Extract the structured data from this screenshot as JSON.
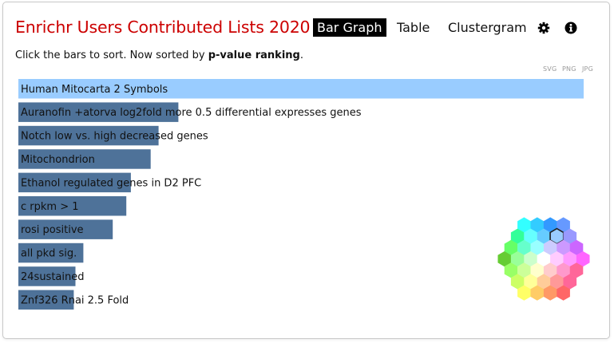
{
  "header": {
    "title": "Enrichr Users Contributed Lists 2020",
    "tabs": [
      {
        "label": "Bar Graph",
        "active": true
      },
      {
        "label": "Table",
        "active": false
      },
      {
        "label": "Clustergram",
        "active": false
      }
    ],
    "icons": [
      "gear-icon",
      "info-icon"
    ]
  },
  "subtitle": {
    "prefix": "Click the bars to sort. Now sorted by ",
    "emphasis": "p-value ranking",
    "suffix": "."
  },
  "export": {
    "svg": "SVG",
    "png": "PNG",
    "jpg": "JPG"
  },
  "colors": {
    "title": "#cc0000",
    "top_bar": "#99ccff",
    "bar": "#4e7299",
    "active_tab_bg": "#000000"
  },
  "chart_data": {
    "type": "bar",
    "orientation": "horizontal",
    "sorted_by": "p-value ranking",
    "categories": [
      "Human Mitocarta 2 Symbols",
      "Auranofin +atorva log2fold more 0.5 differential expresses genes",
      "Notch low vs. high decreased genes",
      "Mitochondrion",
      "Ethanol regulated genes in D2 PFC",
      "c rpkm > 1",
      "rosi positive",
      "all pkd sig.",
      "24sustained",
      "Znf326 Rnai 2.5 Fold"
    ],
    "values": [
      1.0,
      0.283,
      0.248,
      0.234,
      0.199,
      0.191,
      0.167,
      0.115,
      0.101,
      0.098
    ],
    "value_unit": "relative bar length",
    "highlight_index": 0
  },
  "hexagon_map": {
    "rows": [
      [
        "#33ffff",
        "#33ccff",
        "#3399ff",
        "#6699ff"
      ],
      [
        "#33ff99",
        "#66ffff",
        "#66ccff",
        "#99ccff",
        "#9999ff"
      ],
      [
        "#66ff66",
        "#66ffcc",
        "#99ffff",
        "#ccccff",
        "#cc99ff",
        "#cc66ff"
      ],
      [
        "#66cc33",
        "#99ff99",
        "#ccffcc",
        "#ffffff",
        "#ffccff",
        "#ff99ff",
        "#ff66ff"
      ],
      [
        "#99ff66",
        "#ccff99",
        "#ffffcc",
        "#ffcccc",
        "#ff99cc",
        "#ff6699"
      ],
      [
        "#ccff66",
        "#ffff99",
        "#ffcc99",
        "#ff9999",
        "#ff6699"
      ],
      [
        "#ffff66",
        "#ffcc66",
        "#ff9966",
        "#ff6666"
      ]
    ],
    "selected": {
      "row": 1,
      "col": 3
    }
  }
}
